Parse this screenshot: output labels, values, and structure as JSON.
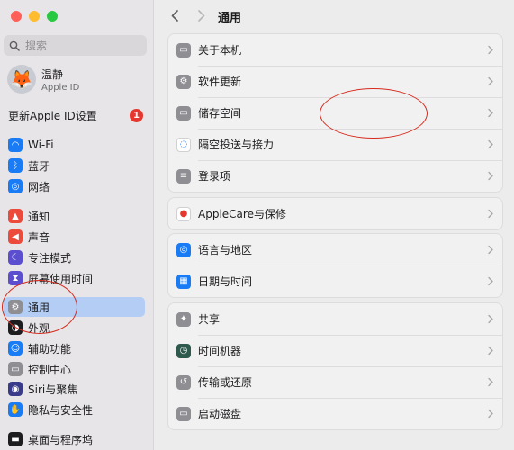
{
  "window": {
    "traffic_lights": [
      "close",
      "minimize",
      "zoom"
    ]
  },
  "sidebar": {
    "search": {
      "placeholder": "搜索"
    },
    "account": {
      "name": "温静",
      "subtitle": "Apple ID",
      "avatar": "🦊"
    },
    "update": {
      "label": "更新Apple ID设置",
      "badge": "1"
    },
    "items": [
      {
        "id": "wifi",
        "label": "Wi-Fi",
        "icon": "wifi-icon",
        "color": "#1a7cf5",
        "glyph": "◠"
      },
      {
        "id": "bluetooth",
        "label": "蓝牙",
        "icon": "bluetooth-icon",
        "color": "#1a7cf5",
        "glyph": "ᛒ"
      },
      {
        "id": "network",
        "label": "网络",
        "icon": "globe-icon",
        "color": "#1a7cf5",
        "glyph": "◎"
      },
      {
        "id": "notifications",
        "label": "通知",
        "icon": "bell-icon",
        "color": "#ec4b3c",
        "glyph": "▲"
      },
      {
        "id": "sound",
        "label": "声音",
        "icon": "speaker-icon",
        "color": "#ec4b3c",
        "glyph": "◀"
      },
      {
        "id": "focus",
        "label": "专注模式",
        "icon": "moon-icon",
        "color": "#5b4fd0",
        "glyph": "☾"
      },
      {
        "id": "screen-time",
        "label": "屏幕使用时间",
        "icon": "hourglass-icon",
        "color": "#5b4fd0",
        "glyph": "⧗"
      },
      {
        "id": "general",
        "label": "通用",
        "icon": "gear-icon",
        "color": "#8e8e93",
        "glyph": "⚙"
      },
      {
        "id": "appearance",
        "label": "外观",
        "icon": "appearance-icon",
        "color": "#1d1d1f",
        "glyph": "◑"
      },
      {
        "id": "accessibility",
        "label": "辅助功能",
        "icon": "accessibility-icon",
        "color": "#1a7cf5",
        "glyph": "☺"
      },
      {
        "id": "control-center",
        "label": "控制中心",
        "icon": "switches-icon",
        "color": "#8e8e93",
        "glyph": "▭"
      },
      {
        "id": "siri",
        "label": "Siri与聚焦",
        "icon": "siri-icon",
        "color": "#3a3a8a",
        "glyph": "◉"
      },
      {
        "id": "privacy",
        "label": "隐私与安全性",
        "icon": "hand-icon",
        "color": "#1a7cf5",
        "glyph": "✋"
      },
      {
        "id": "desktop",
        "label": "桌面与程序坞",
        "icon": "desktop-icon",
        "color": "#1d1d1f",
        "glyph": "▬"
      }
    ]
  },
  "toolbar": {
    "title": "通用"
  },
  "groups": [
    [
      {
        "id": "about",
        "label": "关于本机",
        "icon": "laptop-icon",
        "color": "#8e8e93",
        "glyph": "▭"
      },
      {
        "id": "software-update",
        "label": "软件更新",
        "icon": "gear-badge-icon",
        "color": "#8e8e93",
        "glyph": "⚙"
      },
      {
        "id": "storage",
        "label": "储存空间",
        "icon": "drive-icon",
        "color": "#8e8e93",
        "glyph": "▭"
      },
      {
        "id": "airdrop",
        "label": "隔空投送与接力",
        "icon": "airdrop-icon",
        "color": "#ffffff",
        "glyph": "◌"
      },
      {
        "id": "login-items",
        "label": "登录项",
        "icon": "list-icon",
        "color": "#8e8e93",
        "glyph": "≡"
      }
    ],
    [
      {
        "id": "applecare",
        "label": "AppleCare与保修",
        "icon": "apple-icon",
        "color": "#ffffff",
        "glyph": "●"
      }
    ],
    [
      {
        "id": "language",
        "label": "语言与地区",
        "icon": "globe-icon",
        "color": "#1a7cf5",
        "glyph": "◎"
      },
      {
        "id": "datetime",
        "label": "日期与时间",
        "icon": "calendar-icon",
        "color": "#1a7cf5",
        "glyph": "▦"
      }
    ],
    [
      {
        "id": "sharing",
        "label": "共享",
        "icon": "sharing-icon",
        "color": "#8e8e93",
        "glyph": "✦"
      },
      {
        "id": "time-machine",
        "label": "时间机器",
        "icon": "time-machine-icon",
        "color": "#2e5a4e",
        "glyph": "◷"
      },
      {
        "id": "transfer-reset",
        "label": "传输或还原",
        "icon": "reset-icon",
        "color": "#8e8e93",
        "glyph": "↺"
      },
      {
        "id": "startup-disk",
        "label": "启动磁盘",
        "icon": "disk-icon",
        "color": "#8e8e93",
        "glyph": "▭"
      }
    ]
  ]
}
